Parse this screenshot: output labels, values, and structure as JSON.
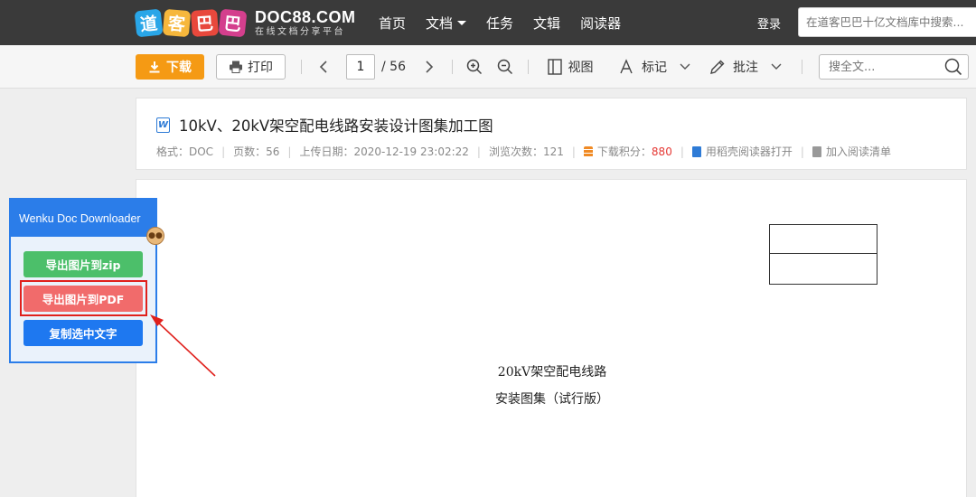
{
  "nav": {
    "logo_tiles": [
      "道",
      "客",
      "巴",
      "巴"
    ],
    "logo_main": "DOC88.COM",
    "logo_sub": "在线文档分享平台",
    "links": [
      {
        "label": "首页"
      },
      {
        "label": "文档"
      },
      {
        "label": "任务"
      },
      {
        "label": "文辑"
      },
      {
        "label": "阅读器"
      }
    ],
    "login": "登录",
    "search_placeholder": "在道客巴巴十亿文档库中搜索..."
  },
  "toolbar": {
    "download_label": "下载",
    "print_label": "打印",
    "current_page": "1",
    "total_pages": "/ 56",
    "view_label": "视图",
    "mark_label": "标记",
    "annotate_label": "批注",
    "search_placeholder": "搜全文..."
  },
  "doc": {
    "title": "10kV、20kV架空配电线路安装设计图集加工图",
    "format": "格式：DOC",
    "pages": "页数：56",
    "upload_date": "上传日期：2020-12-19 23:02:22",
    "views": "浏览次数：121",
    "points_label": "下载积分：",
    "points_value": "880",
    "open_reader": "用稻壳阅读器打开",
    "add_list": "加入阅读清单"
  },
  "page": {
    "line1": "20kV架空配电线路",
    "line2": "安装图集（试行版）"
  },
  "plugin": {
    "title": "Wenku Doc Downloader",
    "btn_zip": "导出图片到zip",
    "btn_pdf": "导出图片到PDF",
    "btn_copy": "复制选中文字"
  },
  "colors": {
    "nav_bg": "#3a3a3a",
    "download_orange": "#f59a14",
    "plugin_blue": "#2b7de9",
    "zip_green": "#4cbf6a",
    "pdf_red": "#f16b6b",
    "copy_blue": "#1e78f0",
    "highlight_red": "#e0201c"
  }
}
